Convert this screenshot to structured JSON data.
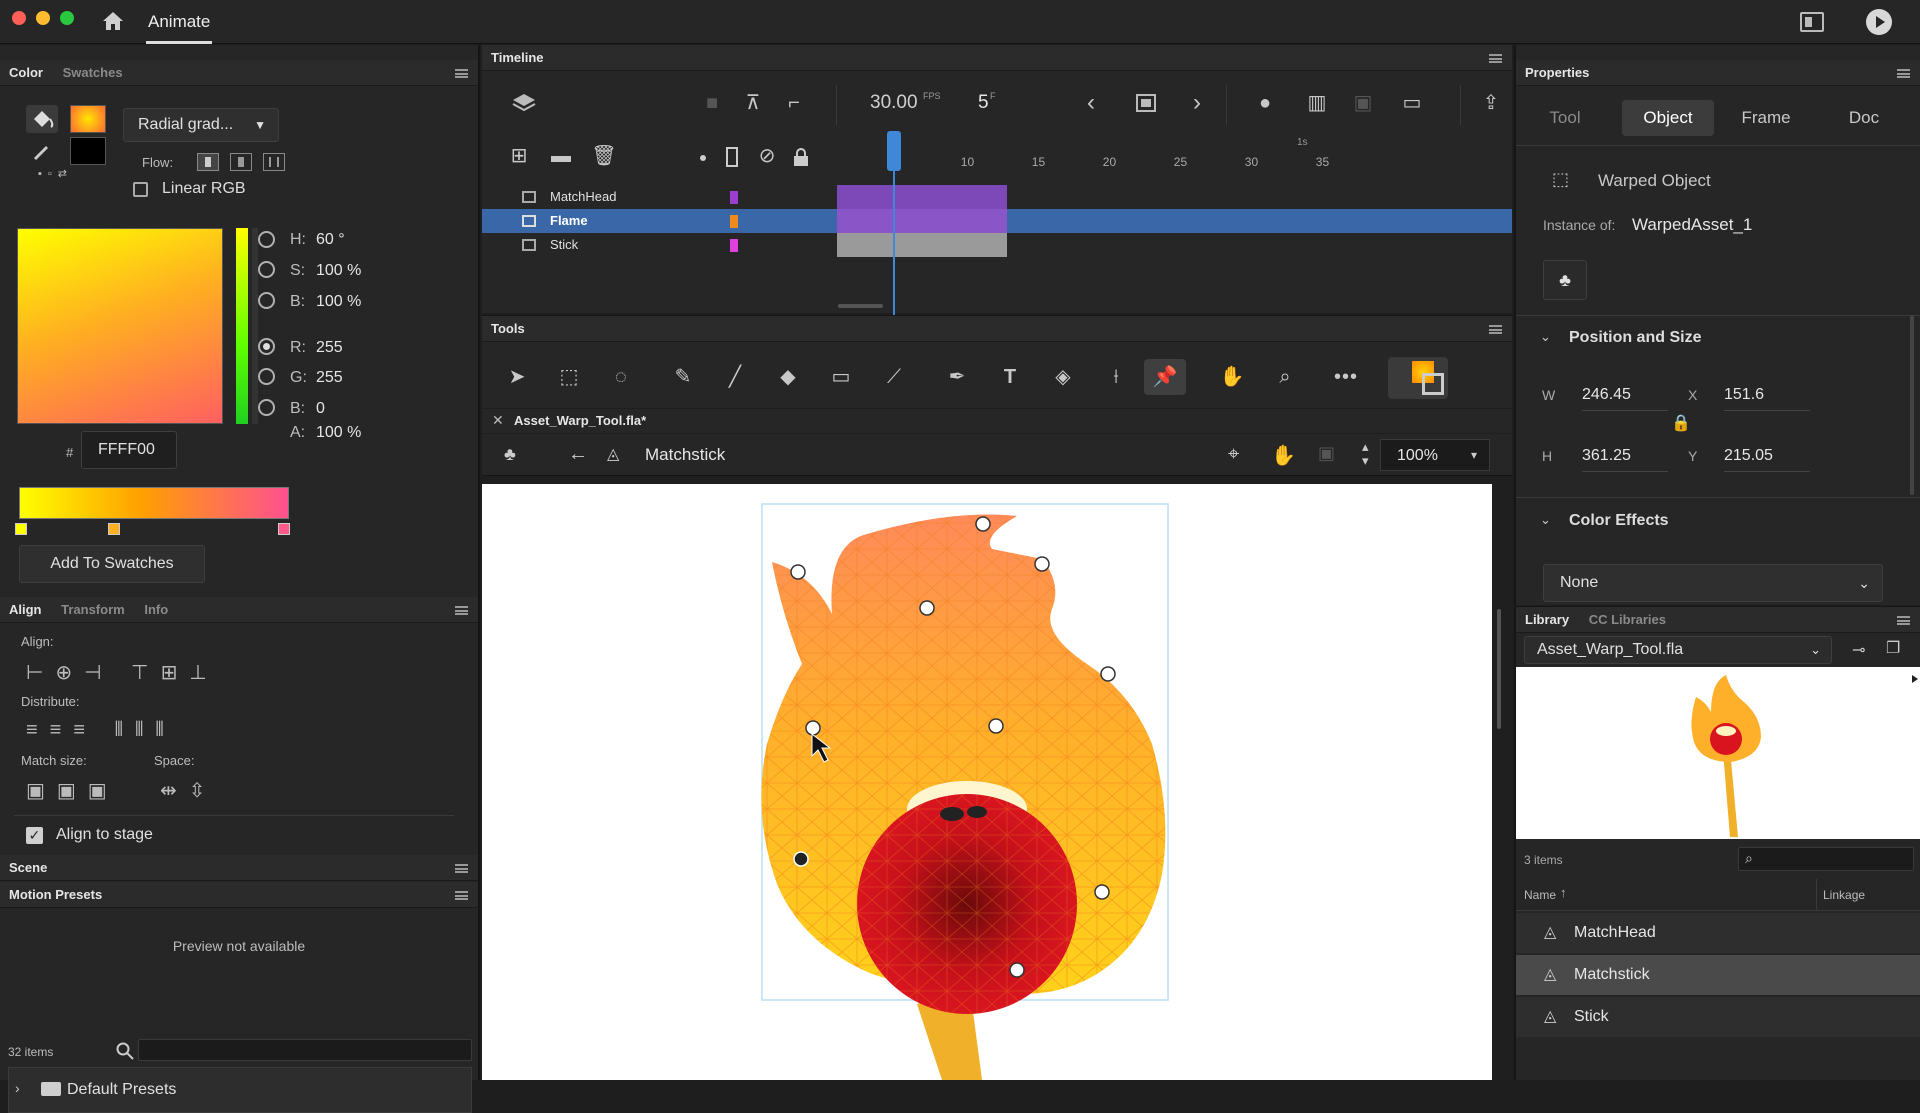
{
  "app": {
    "title": "Animate"
  },
  "color_panel": {
    "tabs": [
      "Color",
      "Swatches"
    ],
    "fill_type": "Radial grad...",
    "flow_label": "Flow:",
    "linear_rgb_label": "Linear RGB",
    "h_label": "H:",
    "h_value": "60 °",
    "s_label": "S:",
    "s_value": "100 %",
    "b_label": "B:",
    "b_value": "100 %",
    "r_label": "R:",
    "r_value": "255",
    "g_label": "G:",
    "g_value": "255",
    "b2_label": "B:",
    "b2_value": "0",
    "a_label": "A:",
    "a_value": "100 %",
    "hash": "#",
    "hex": "FFFF00",
    "add_swatches": "Add To Swatches"
  },
  "align_panel": {
    "tabs": [
      "Align",
      "Transform",
      "Info"
    ],
    "align_label": "Align:",
    "distribute_label": "Distribute:",
    "match_size_label": "Match size:",
    "space_label": "Space:",
    "align_to_stage": "Align to stage"
  },
  "scene_panel": {
    "title": "Scene"
  },
  "motion_presets": {
    "title": "Motion Presets",
    "preview": "Preview not available",
    "count": "32 items",
    "folder": "Default Presets"
  },
  "timeline": {
    "title": "Timeline",
    "fps": "30.00",
    "fps_unit": "FPS",
    "frame": "5",
    "frame_unit": "F",
    "ruler_marks": [
      "5",
      "10",
      "15",
      "20",
      "25",
      "30",
      "35"
    ],
    "sec_mark": "1s",
    "playhead_frame": 5,
    "layers": [
      {
        "name": "MatchHead",
        "color": "#9a3fd0"
      },
      {
        "name": "Flame",
        "color": "#f08a1a"
      },
      {
        "name": "Stick",
        "color": "#e040e0"
      }
    ]
  },
  "tools": {
    "title": "Tools"
  },
  "document": {
    "tab": "Asset_Warp_Tool.fla*",
    "breadcrumb": "Matchstick",
    "zoom": "100%"
  },
  "properties": {
    "title": "Properties",
    "tabs": [
      "Tool",
      "Object",
      "Frame",
      "Doc"
    ],
    "object_type": "Warped Object",
    "instance_label": "Instance of:",
    "instance_value": "WarpedAsset_1",
    "position_size": "Position and Size",
    "w_label": "W",
    "w_value": "246.45",
    "x_label": "X",
    "x_value": "151.6",
    "h_label": "H",
    "h_value": "361.25",
    "y_label": "Y",
    "y_value": "215.05",
    "color_effects": "Color Effects",
    "color_effect_value": "None"
  },
  "library": {
    "tabs": [
      "Library",
      "CC Libraries"
    ],
    "file": "Asset_Warp_Tool.fla",
    "count": "3 items",
    "col_name": "Name",
    "col_linkage": "Linkage",
    "items": [
      "MatchHead",
      "Matchstick",
      "Stick"
    ]
  },
  "colors": {
    "accent": "#2f6fb3",
    "flame_orange": "#f7a21b",
    "flame_yellow": "#ffd21a",
    "head_red": "#d9141e",
    "stick": "#f0b02a"
  }
}
